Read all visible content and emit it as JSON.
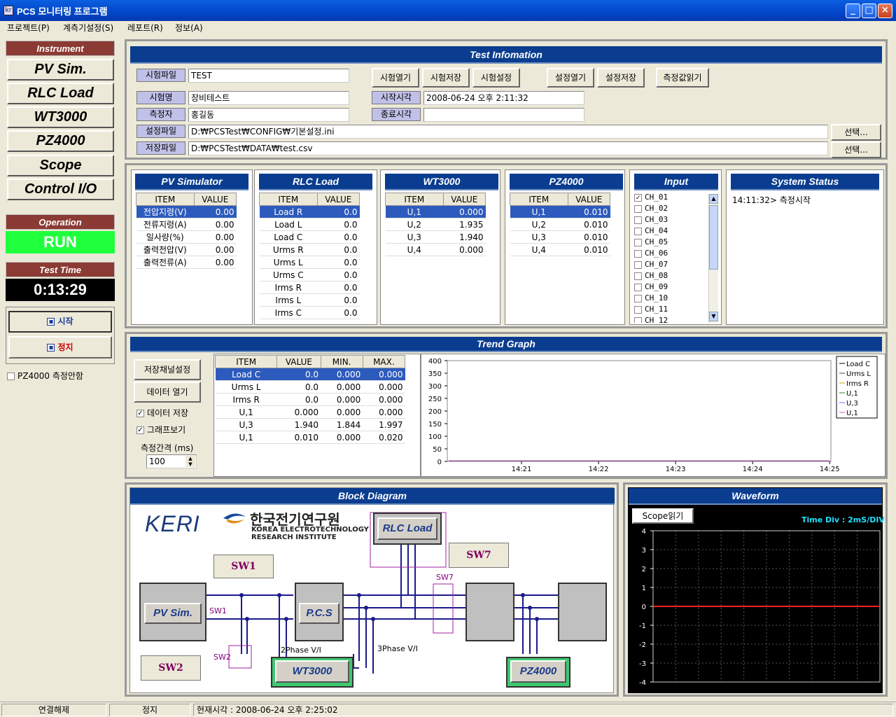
{
  "window": {
    "title": "PCS 모니터링 프로그램",
    "app_icon": "kr",
    "min": "_",
    "max": "□",
    "close": "×"
  },
  "menu": [
    "프로젝트(P)",
    "계측기설정(S)",
    "레포트(R)",
    "정보(A)"
  ],
  "left": {
    "instrument_hdr": "Instrument",
    "instruments": [
      "PV Sim.",
      "RLC Load",
      "WT3000",
      "PZ4000",
      "Scope",
      "Control I/O"
    ],
    "operation_hdr": "Operation",
    "operation_value": "RUN",
    "testtime_hdr": "Test Time",
    "testtime_value": "0:13:29",
    "start_label": "시작",
    "stop_label": "정지",
    "pz_check_label": "PZ4000 측정안함"
  },
  "testinfo": {
    "header": "Test Infomation",
    "file_lbl": "시험파일",
    "file_val": "TEST",
    "name_lbl": "시험명",
    "name_val": "장비테스트",
    "person_lbl": "측정자",
    "person_val": "홍길동",
    "conf_lbl": "설정파일",
    "conf_val": "D:₩PCSTest₩CONFIG₩기본설정.ini",
    "save_lbl": "저장파일",
    "save_val": "D:₩PCSTest₩DATA₩test.csv",
    "start_lbl": "시작시각",
    "start_val": "2008-06-24 오후 2:11:32",
    "end_lbl": "종료시각",
    "end_val": "",
    "btn_open": "시험열기",
    "btn_save": "시험저장",
    "btn_setting": "시험설정",
    "btn_cfgopen": "설정열기",
    "btn_cfgsave": "설정저장",
    "btn_read": "측정값읽기",
    "btn_select": "선택..."
  },
  "pvsim": {
    "header": "PV Simulator",
    "cols": [
      "ITEM",
      "VALUE"
    ],
    "rows": [
      [
        "전압지령(V)",
        "0.00"
      ],
      [
        "전류지령(A)",
        "0.00"
      ],
      [
        "일사량(%)",
        "0.00"
      ],
      [
        "출력전압(V)",
        "0.00"
      ],
      [
        "출력전류(A)",
        "0.00"
      ]
    ]
  },
  "rlc": {
    "header": "RLC Load",
    "cols": [
      "ITEM",
      "VALUE"
    ],
    "rows": [
      [
        "Load R",
        "0.0"
      ],
      [
        "Load L",
        "0.0"
      ],
      [
        "Load C",
        "0.0"
      ],
      [
        "Urms R",
        "0.0"
      ],
      [
        "Urms L",
        "0.0"
      ],
      [
        "Urms C",
        "0.0"
      ],
      [
        "Irms R",
        "0.0"
      ],
      [
        "Irms L",
        "0.0"
      ],
      [
        "Irms C",
        "0.0"
      ]
    ]
  },
  "wt": {
    "header": "WT3000",
    "cols": [
      "ITEM",
      "VALUE"
    ],
    "rows": [
      [
        "U,1",
        "0.000"
      ],
      [
        "U,2",
        "1.935"
      ],
      [
        "U,3",
        "1.940"
      ],
      [
        "U,4",
        "0.000"
      ]
    ]
  },
  "pz": {
    "header": "PZ4000",
    "cols": [
      "ITEM",
      "VALUE"
    ],
    "rows": [
      [
        "U,1",
        "0.010"
      ],
      [
        "U,2",
        "0.010"
      ],
      [
        "U,3",
        "0.010"
      ],
      [
        "U,4",
        "0.010"
      ]
    ]
  },
  "input": {
    "header": "Input",
    "channels": [
      "CH_01",
      "CH_02",
      "CH_03",
      "CH_04",
      "CH_05",
      "CH_06",
      "CH_07",
      "CH_08",
      "CH_09",
      "CH_10",
      "CH_11",
      "CH_12"
    ],
    "checked": [
      true,
      false,
      false,
      false,
      false,
      false,
      false,
      false,
      false,
      false,
      false,
      false
    ]
  },
  "sysstatus": {
    "header": "System Status",
    "log": "14:11:32> 측정시작"
  },
  "trend": {
    "header": "Trend Graph",
    "btn_channel": "저장채널설정",
    "btn_open": "데이터 열기",
    "chk_save": "데이터 저장",
    "chk_graph": "그래프보기",
    "interval_lbl": "측정간격 (ms)",
    "interval_val": "100",
    "cols": [
      "ITEM",
      "VALUE",
      "MIN.",
      "MAX."
    ],
    "rows": [
      [
        "Load C",
        "0.0",
        "0.000",
        "0.000"
      ],
      [
        "Urms L",
        "0.0",
        "0.000",
        "0.000"
      ],
      [
        "Irms R",
        "0.0",
        "0.000",
        "0.000"
      ],
      [
        "U,1",
        "0.000",
        "0.000",
        "0.000"
      ],
      [
        "U,3",
        "1.940",
        "1.844",
        "1.997"
      ],
      [
        "U,1",
        "0.010",
        "0.000",
        "0.020"
      ]
    ]
  },
  "chart_data": [
    {
      "type": "line",
      "title": "",
      "xlabel": "",
      "ylabel": "",
      "x": [
        "14:21",
        "14:22",
        "14:23",
        "14:24",
        "14:25"
      ],
      "ylim": [
        0,
        400
      ],
      "yticks": [
        0,
        50,
        100,
        150,
        200,
        250,
        300,
        350,
        400
      ],
      "legend": "top-right",
      "series": [
        {
          "name": "Load C",
          "values": [
            0,
            0,
            0,
            0,
            0
          ]
        },
        {
          "name": "Urms L",
          "values": [
            0,
            0,
            0,
            0,
            0
          ]
        },
        {
          "name": "Irms R",
          "values": [
            0,
            0,
            0,
            0,
            0
          ]
        },
        {
          "name": "U,1",
          "values": [
            0,
            0,
            0,
            0,
            0
          ]
        },
        {
          "name": "U,3",
          "values": [
            0,
            0,
            0,
            0,
            0
          ]
        },
        {
          "name": "U,1",
          "values": [
            0,
            0,
            0,
            0,
            0
          ]
        }
      ],
      "colors": [
        "#000000",
        "#4a4a4a",
        "#c8a000",
        "#2a8a2a",
        "#7070ff",
        "#c060c0"
      ]
    },
    {
      "type": "line",
      "title": "",
      "ylim": [
        -4,
        4
      ],
      "yticks": [
        4,
        3,
        2,
        1,
        0,
        -1,
        -2,
        -3,
        -4
      ],
      "series": [
        {
          "values": [
            0,
            0
          ]
        }
      ],
      "colors": [
        "#ff2020"
      ],
      "background": "#000000",
      "grid": true
    }
  ],
  "block": {
    "header": "Block Diagram",
    "logo_keri": "KERI",
    "logo_kr": "한국전기연구원",
    "logo_en1": "KOREA ELECTROTECHNOLOGY",
    "logo_en2": "RESEARCH INSTITUTE",
    "sw1": "SW1",
    "sw2": "SW2",
    "sw7": "SW7",
    "pvsim": "PV Sim.",
    "pcs": "P.C.S",
    "rlc": "RLC Load",
    "wt": "WT3000",
    "pz": "PZ4000",
    "small_sw1": "SW1",
    "small_sw2": "SW2",
    "small_sw7": "SW7",
    "phase2": "2Phase V/I",
    "phase3": "3Phase V/I"
  },
  "waveform": {
    "header": "Waveform",
    "btn": "Scope읽기",
    "timediv": "Time Div : 2mS/DIV"
  },
  "statusbar": {
    "conn": "연결해제",
    "state": "정지",
    "time": "현재시각 : 2008-06-24 오후 2:25:02"
  }
}
